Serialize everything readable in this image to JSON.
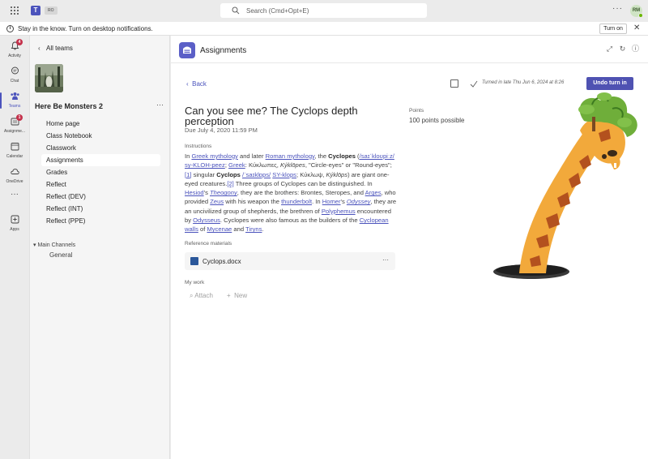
{
  "topbar": {
    "org_badge": "RO",
    "search_placeholder": "Search (Cmd+Opt+E)",
    "more": "···",
    "avatar_initials": "RM"
  },
  "notification": {
    "message": "Stay in the know. Turn on desktop notifications.",
    "action": "Turn on",
    "close": "✕"
  },
  "rail": {
    "items": [
      {
        "label": "Activity",
        "badge": "4"
      },
      {
        "label": "Chat"
      },
      {
        "label": "Teams"
      },
      {
        "label": "Assignme...",
        "badge": "1"
      },
      {
        "label": "Calendar"
      },
      {
        "label": "OneDrive"
      },
      {
        "label": "···"
      },
      {
        "label": "Apps"
      }
    ]
  },
  "sidepanel": {
    "back": "All teams",
    "team_name": "Here Be Monsters 2",
    "more": "···",
    "nav": [
      "Home page",
      "Class Notebook",
      "Classwork",
      "Assignments",
      "Grades",
      "Reflect",
      "Reflect (DEV)",
      "Reflect (INT)",
      "Reflect (PPE)"
    ],
    "channels_header": "Main Channels",
    "channel": "General"
  },
  "main": {
    "app_title": "Assignments",
    "back": "Back",
    "turned_in": "Turned in late Thu Jun 6, 2024 at 8:26",
    "turn_in_button": "Undo turn in",
    "title": "Can you see me? The Cyclops depth perception",
    "due": "Due July 4, 2020 11:59 PM",
    "points_label": "Points",
    "points_value": "100 points possible",
    "instructions_label": "Instructions",
    "instructions": {
      "p1": "In ",
      "l1": "Greek mythology",
      "p2": " and later ",
      "l2": "Roman mythology",
      "p3": ", the ",
      "b1": "Cyclopes",
      "p4": " (",
      "l3": "/saɪˈkloʊpiːz/",
      "p5": " ",
      "l4": "sy-KLOH-peez",
      "p6": "; ",
      "l5": "Greek",
      "p7": ": Κύκλωπες, ",
      "i1": "Kýklōpes",
      "p8": ", \"Circle-eyes\" or \"Round-eyes\";",
      "l6": "[1]",
      "p9": " singular ",
      "b2": "Cyclops",
      "p10": " ",
      "l7": "/ˈsaɪklɒps/",
      "p11": " ",
      "l8": "SY-klops",
      "p12": "; Κύκλωψ, ",
      "i2": "Kýklōps",
      "p13": ") are giant one-eyed creatures.",
      "l9": "[2]",
      "p14": " Three groups of Cyclopes can be distinguished. In ",
      "l10": "Hesiod",
      "p15": "'s ",
      "l11": "Theogony",
      "p16": ", they are the brothers: Brontes, Steropes, and ",
      "l12": "Arges",
      "p17": ", who provided ",
      "l13": "Zeus",
      "p18": " with his weapon the ",
      "l14": "thunderbolt",
      "p19": ". In ",
      "l15": "Homer",
      "p20": "'s ",
      "l16": "Odyssey",
      "p21": ", they are an uncivilized group of shepherds, the brethren of ",
      "l17": "Polyphemus",
      "p22": " encountered by ",
      "l18": "Odysseus",
      "p23": ". Cyclopes were also famous as the builders of the ",
      "l19": "Cyclopean walls",
      "p24": " of ",
      "l20": "Mycenae",
      "p25": " and ",
      "l21": "Tiryns",
      "p26": "."
    },
    "reference_label": "Reference materials",
    "file_name": "Cyclops.docx",
    "file_more": "···",
    "my_work_label": "My work",
    "attach": "Attach",
    "new": "New"
  },
  "colors": {
    "brand": "#4b53bc",
    "badge": "#c4314b",
    "presence": "#6bb700",
    "word": "#2b579a"
  }
}
